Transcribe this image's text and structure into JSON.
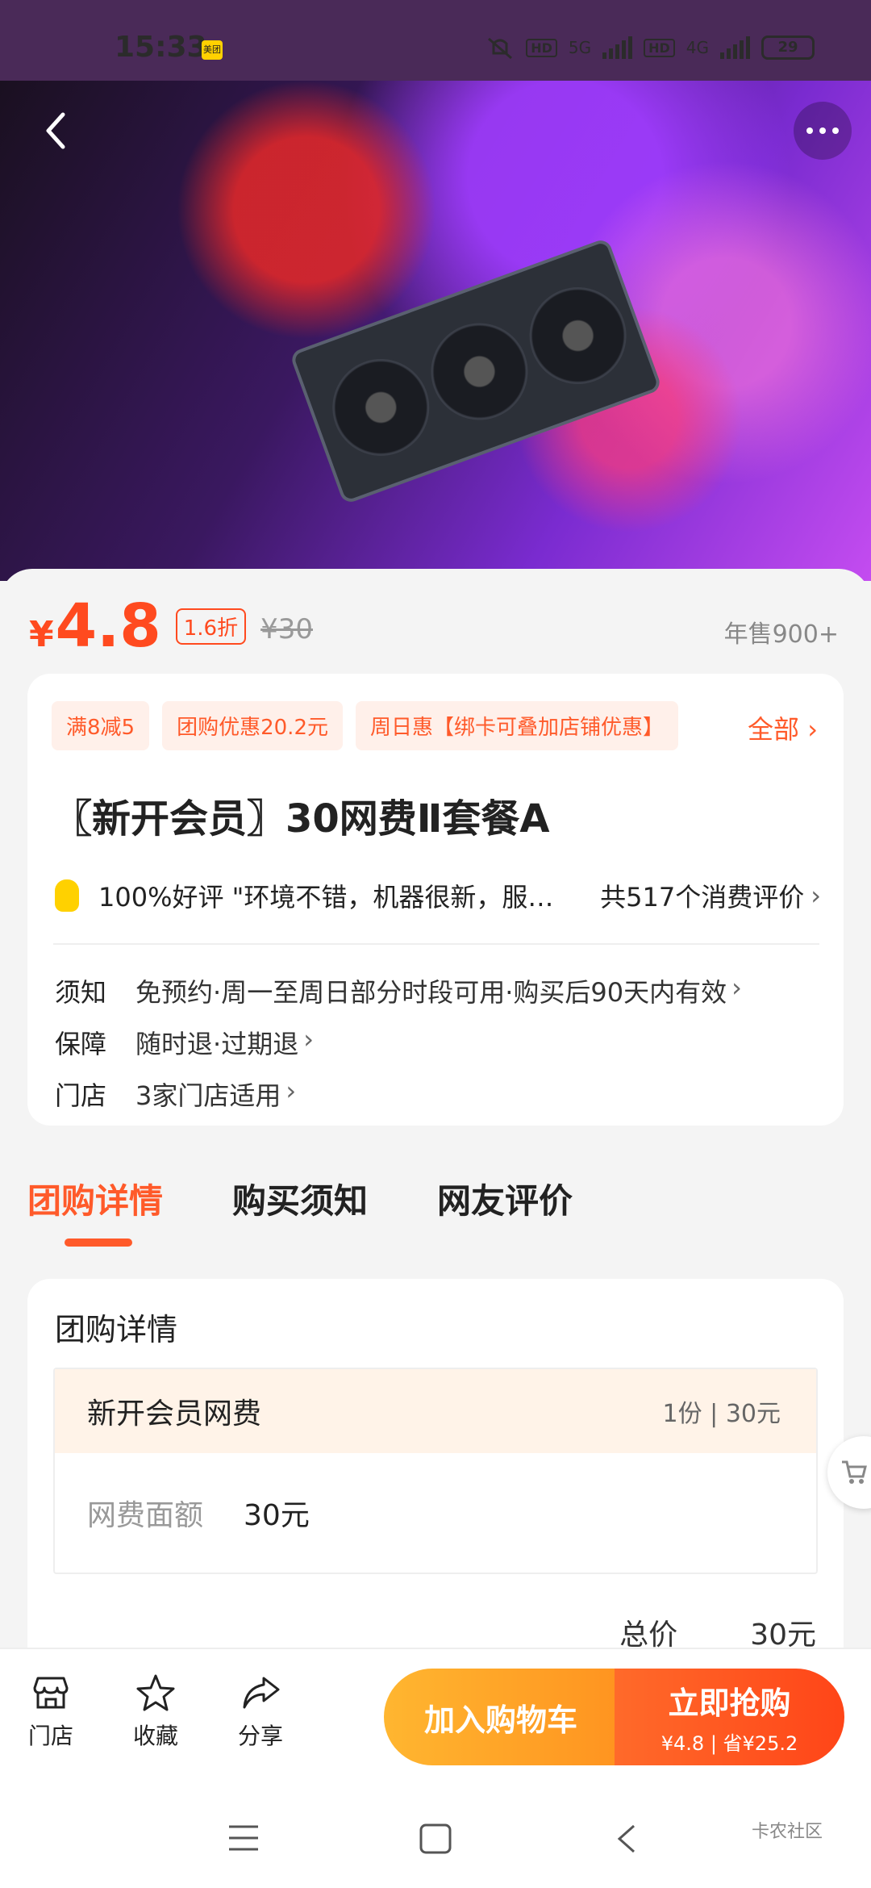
{
  "status_bar": {
    "time": "15:33",
    "app_badge": "美团",
    "hd1": "HD",
    "net1": "5G",
    "hd2": "HD",
    "net2": "4G",
    "battery": "29"
  },
  "price": {
    "currency": "¥",
    "value": "4.8",
    "discount": "1.6折",
    "original": "¥30",
    "annual_sales": "年售900+"
  },
  "promo_tags": [
    "满8减5",
    "团购优惠20.2元",
    "周日惠【绑卡可叠加店铺优惠】"
  ],
  "promo_all": "全部",
  "title": "〖新开会员〗30网费Ⅱ套餐A",
  "review": {
    "summary": "100%好评 \"环境不错，机器很新，服…",
    "count": "共517个消费评价"
  },
  "info": [
    {
      "key": "须知",
      "value": "免预约·周一至周日部分时段可用·购买后90天内有效"
    },
    {
      "key": "保障",
      "value": "随时退·过期退"
    },
    {
      "key": "门店",
      "value": "3家门店适用"
    }
  ],
  "tabs": [
    "团购详情",
    "购买须知",
    "网友评价"
  ],
  "details": {
    "heading": "团购详情",
    "package_name": "新开会员网费",
    "package_qty": "1份 | 30元",
    "row_label": "网费面额",
    "row_value": "30元",
    "total_label": "总价",
    "total_value": "30元"
  },
  "bottom_bar": {
    "store": "门店",
    "favorite": "收藏",
    "share": "分享",
    "add_cart": "加入购物车",
    "buy_now": "立即抢购",
    "buy_sub": "¥4.8 | 省¥25.2"
  },
  "watermark": "卡农社区"
}
